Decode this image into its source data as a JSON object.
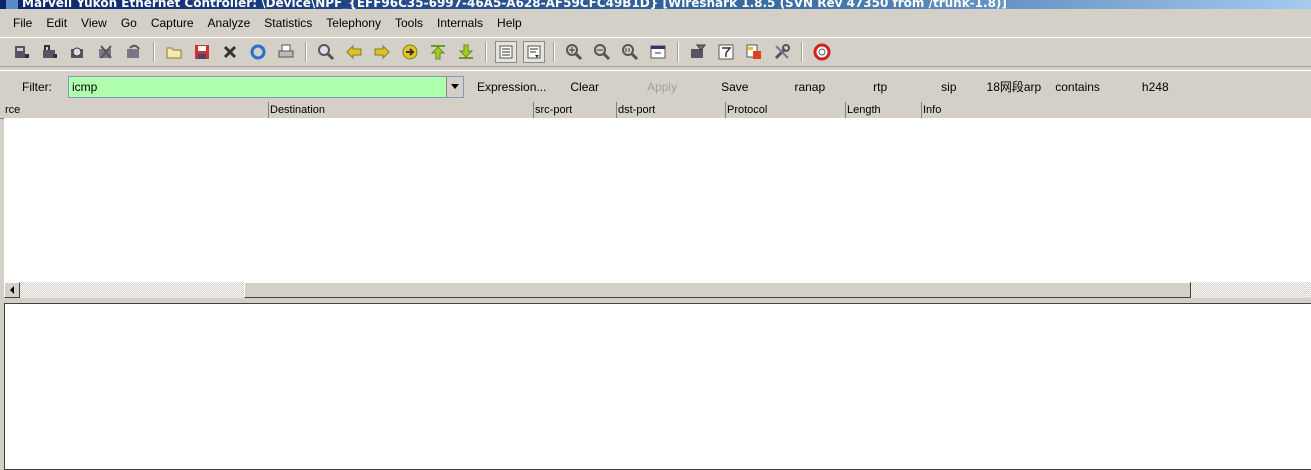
{
  "window": {
    "title": "Marvell Yukon Ethernet Controller: \\Device\\NPF_{EFF96C35-6997-46A5-A628-AF59CFC49B1D}   [Wireshark 1.8.5  (SVN Rev 47350 from /trunk-1.8)]"
  },
  "menu": {
    "file": "File",
    "edit": "Edit",
    "view": "View",
    "go": "Go",
    "capture": "Capture",
    "analyze": "Analyze",
    "statistics": "Statistics",
    "telephony": "Telephony",
    "tools": "Tools",
    "internals": "Internals",
    "help": "Help"
  },
  "filter": {
    "label": "Filter:",
    "value": "icmp",
    "buttons": {
      "expression": "Expression...",
      "clear": "Clear",
      "apply": "Apply",
      "save": "Save",
      "ranap": "ranap",
      "rtp": "rtp",
      "sip": "sip",
      "arp18": "18网段arp",
      "contains": "contains",
      "h248": "h248"
    }
  },
  "packet_list": {
    "columns": {
      "source": "rce",
      "destination": "Destination",
      "src_port": "src-port",
      "dst_port": "dst-port",
      "protocol": "Protocol",
      "length": "Length",
      "info": "Info"
    }
  },
  "colors": {
    "filter_valid": "#afffaf",
    "title_start": "#0a246a"
  }
}
